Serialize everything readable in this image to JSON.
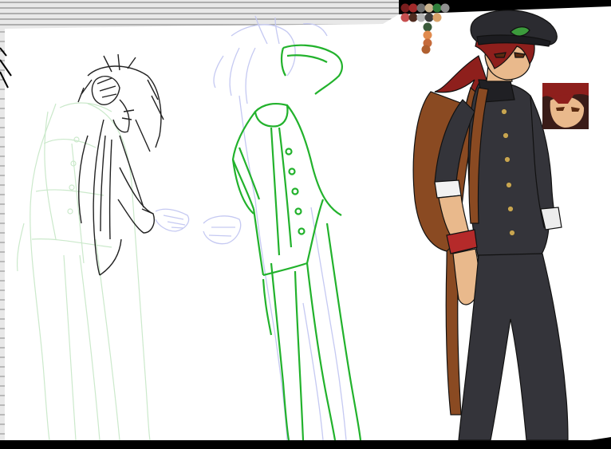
{
  "scene": {
    "background_color": "#000000",
    "paper_color": "#FFFFFF",
    "ruled_line_color": "#8A8A8A",
    "sketch_pale_green": "#CBE9CB",
    "sketch_line_black": "#222222",
    "sketch_light_blue": "#C5C9F2",
    "sketch_bright_green": "#22B22C",
    "uniform_color": "#34343A",
    "uniform_shadow": "#202024",
    "hair_color": "#8E1F1C",
    "hat_color": "#2B2B30",
    "bag_color": "#8A4A22",
    "skin_color": "#E9B98C"
  },
  "palette": {
    "swatches": [
      "#7A1E1E",
      "#A12A2A",
      "#6E6E6E",
      "#C9B28D",
      "#2F7D3A",
      "#8F8F8F",
      "#C74F4F",
      "#4E2A1E",
      "#B6B6B6",
      "#3B3B3B",
      "#D9A36A",
      "#3A5A3A",
      "#E08A4E",
      "#C56A3A",
      "#B06030"
    ]
  },
  "figures": [
    {
      "id": "pale-rough-sketch",
      "style": "pale green underdrawing"
    },
    {
      "id": "lineart-figure",
      "style": "black ink lineart, hand on head"
    },
    {
      "id": "blue-green-sketch",
      "style": "blue rough with green pose lines"
    },
    {
      "id": "colored-figure",
      "style": "colored character in dark school uniform, cap and backpack"
    }
  ],
  "face_closeup": {
    "present": true
  }
}
